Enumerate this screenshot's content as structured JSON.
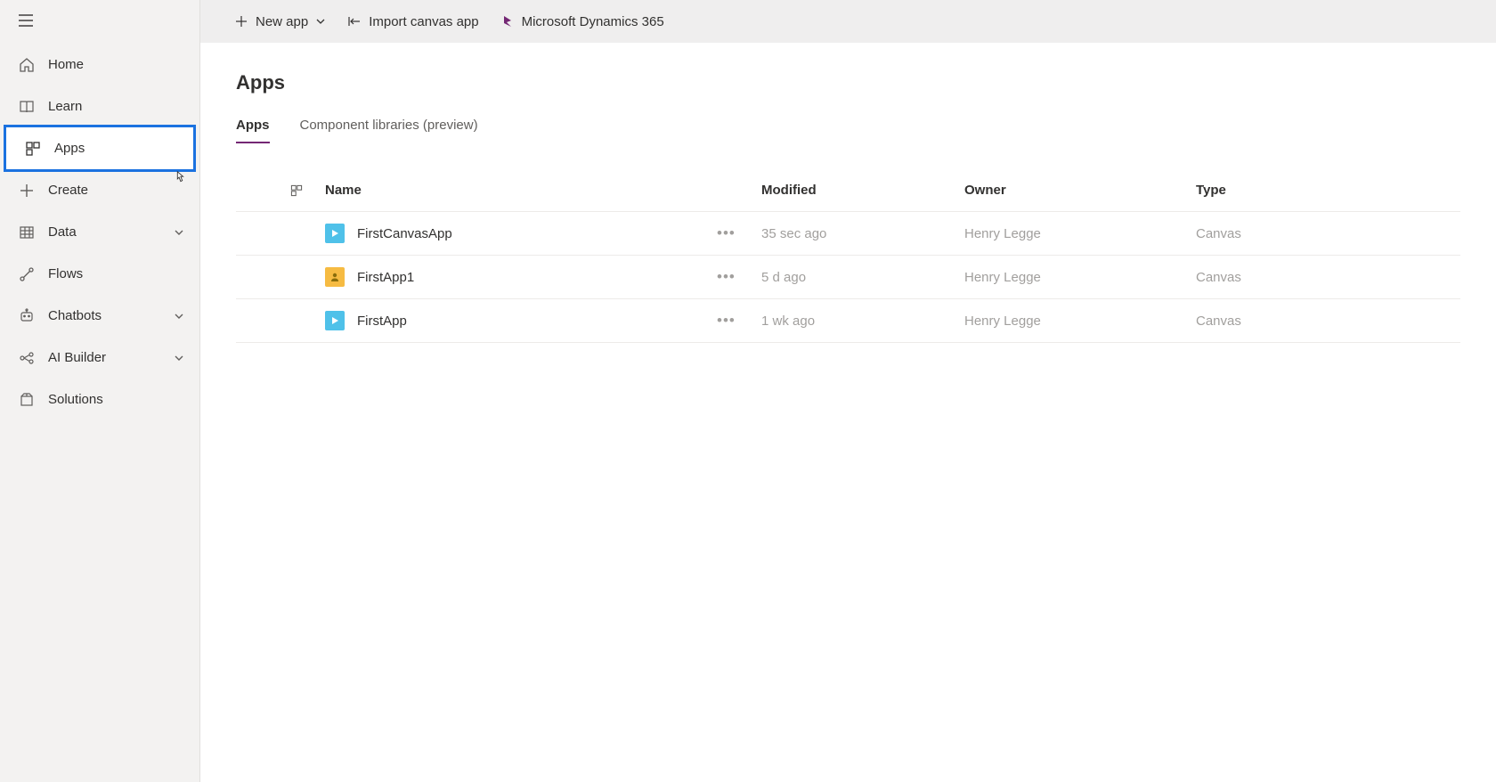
{
  "sidebar": {
    "items": [
      {
        "label": "Home",
        "icon": "home"
      },
      {
        "label": "Learn",
        "icon": "book"
      },
      {
        "label": "Apps",
        "icon": "apps",
        "active": true
      },
      {
        "label": "Create",
        "icon": "plus"
      },
      {
        "label": "Data",
        "icon": "table",
        "chevron": true
      },
      {
        "label": "Flows",
        "icon": "flow"
      },
      {
        "label": "Chatbots",
        "icon": "bot",
        "chevron": true
      },
      {
        "label": "AI Builder",
        "icon": "ai",
        "chevron": true
      },
      {
        "label": "Solutions",
        "icon": "package"
      }
    ]
  },
  "topbar": {
    "new_app": "New app",
    "import": "Import canvas app",
    "dynamics": "Microsoft Dynamics 365"
  },
  "page": {
    "title": "Apps",
    "tabs": [
      {
        "label": "Apps",
        "active": true
      },
      {
        "label": "Component libraries (preview)"
      }
    ]
  },
  "table": {
    "columns": {
      "name": "Name",
      "modified": "Modified",
      "owner": "Owner",
      "type": "Type"
    },
    "rows": [
      {
        "name": "FirstCanvasApp",
        "modified": "35 sec ago",
        "owner": "Henry Legge",
        "type": "Canvas",
        "iconBg": "#4fc1e9",
        "iconKind": "play"
      },
      {
        "name": "FirstApp1",
        "modified": "5 d ago",
        "owner": "Henry Legge",
        "type": "Canvas",
        "iconBg": "#f6bb42",
        "iconKind": "person"
      },
      {
        "name": "FirstApp",
        "modified": "1 wk ago",
        "owner": "Henry Legge",
        "type": "Canvas",
        "iconBg": "#4fc1e9",
        "iconKind": "play"
      }
    ]
  }
}
